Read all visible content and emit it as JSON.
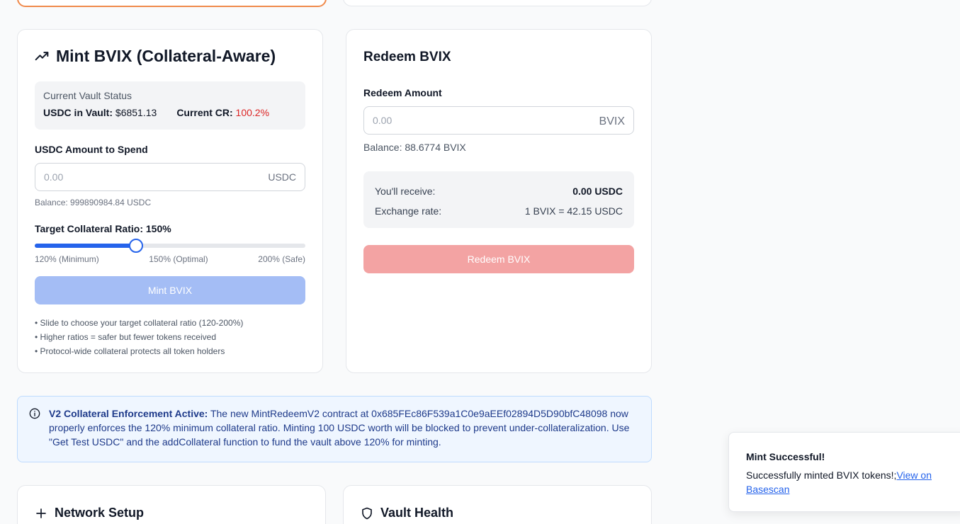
{
  "mint": {
    "title": "Mint BVIX (Collateral-Aware)",
    "vault_status_label": "Current Vault Status",
    "usdc_in_vault_label": "USDC in Vault:",
    "usdc_in_vault_value": "$6851.13",
    "current_cr_label": "Current CR:",
    "current_cr_value": "100.2%",
    "amount_label": "USDC Amount to Spend",
    "amount_placeholder": "0.00",
    "amount_suffix": "USDC",
    "balance": "Balance: 999890984.84 USDC",
    "target_ratio_label": "Target Collateral Ratio: 150%",
    "slider": {
      "min": 120,
      "max": 200,
      "value": 150
    },
    "slider_labels": [
      "120% (Minimum)",
      "150% (Optimal)",
      "200% (Safe)"
    ],
    "button_label": "Mint BVIX",
    "notes": [
      "• Slide to choose your target collateral ratio (120-200%)",
      "• Higher ratios = safer but fewer tokens received",
      "• Protocol-wide collateral protects all token holders"
    ]
  },
  "redeem": {
    "title": "Redeem BVIX",
    "amount_label": "Redeem Amount",
    "amount_placeholder": "0.00",
    "amount_suffix": "BVIX",
    "balance": "Balance: 88.6774 BVIX",
    "receive_label": "You'll receive:",
    "receive_value": "0.00 USDC",
    "rate_label": "Exchange rate:",
    "rate_value": "1 BVIX = 42.15 USDC",
    "button_label": "Redeem BVIX"
  },
  "alert": {
    "title": "V2 Collateral Enforcement Active:",
    "body": " The new MintRedeemV2 contract at 0x685FEc86F539a1C0e9aEEf02894D5D90bfC48098 now properly enforces the 120% minimum collateral ratio. Minting 100 USDC worth will be blocked to prevent under-collateralization. Use \"Get Test USDC\" and the addCollateral function to fund the vault above 120% for minting."
  },
  "bottom": {
    "network_title": "Network Setup",
    "vault_title": "Vault Health"
  },
  "toast": {
    "title": "Mint Successful!",
    "body": "Successfully minted BVIX tokens!;",
    "link": "View on Basescan"
  },
  "colors": {
    "accent_blue": "#2563eb",
    "danger_red": "#dc2626",
    "focus_orange": "#f08a4b"
  }
}
